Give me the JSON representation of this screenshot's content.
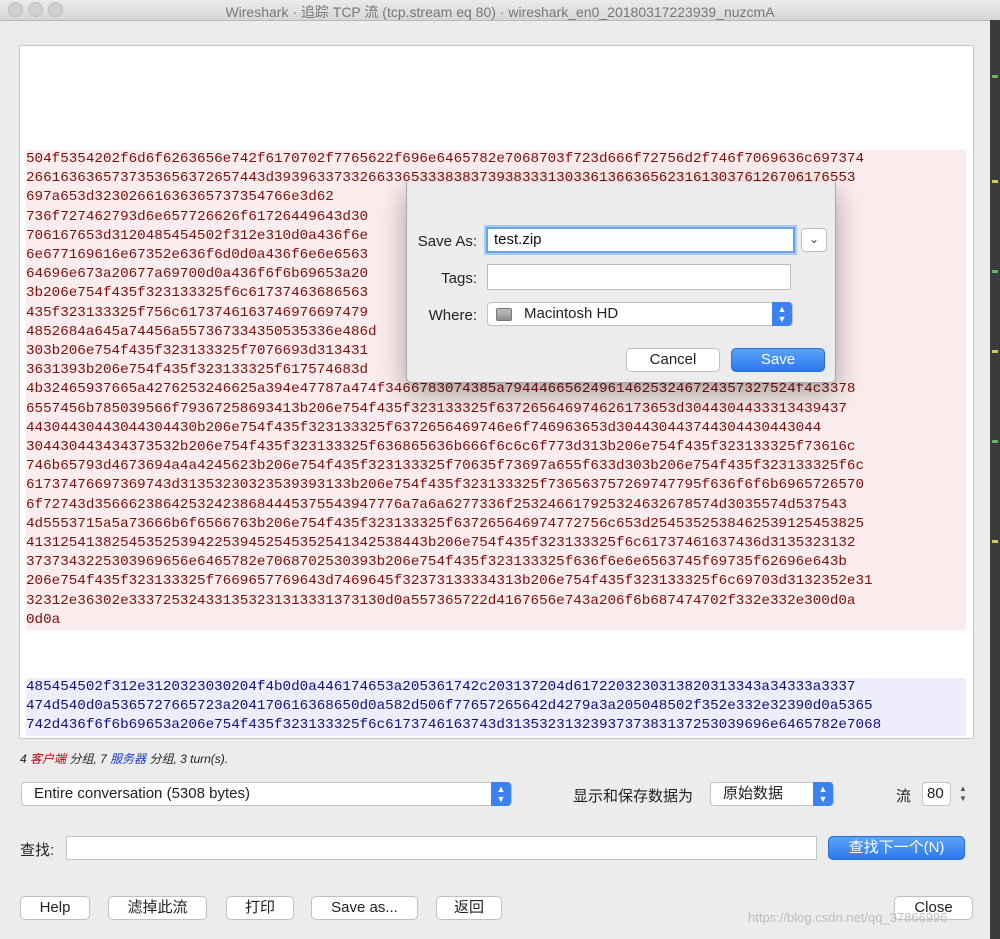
{
  "window": {
    "title": "Wireshark · 追踪 TCP 流 (tcp.stream eq 80) · wireshark_en0_20180317223939_nuzcmA"
  },
  "stream": {
    "client_lines": [
      "504f5354202f6d6f6263656e742f6170702f7765622f696e6465782e7068703f723d666f72756d2f746f7069636c697374",
      "2661636365737353656372657443d39396337332663365333838373938333130336136636562316130376126706176553",
      "697a653d32302661636365737354766e3d62",
      "736f727462793d6e657726626f61726449643d30",
      "706167653d3120485454502f312e310d0a436f6e",
      "6e677169616e67352e636f6d0d0a436f6e6e6563",
      "64696e673a20677a69700d0a436f6f6b69653a20",
      "3b206e754f435f323133325f6c61737463686563",
      "435f323133325f756c6173746163746976697479",
      "4852684a645a74456a557367334350535336e486d",
      "303b206e754f435f323133325f7076693d313431",
      "3631393b206e754f435f323133325f617574683d",
      "4b32465937665a4276253246625a394e47787a474f3466783074385a7944466562496146253246724357327524f4c3378",
      "6557456b785039566f79367258693413b206e754f435f323133325f637265646974626173653d3044304433313439437",
      "44304430443044304430b206e754f435f323133325f6372656469746e6f746963653d304430443744304430443044",
      "304430443434373532b206e754f435f323133325f636865636b666f6c6c6f773d313b206e754f435f323133325f73616c",
      "746b65793d4673694a4a4245623b206e754f435f323133325f70635f73697a655f633d303b206e754f435f323133325f6c",
      "61737476697369743d31353230323539393133b206e754f435f323133325f736563757269747795f636f6f6b6965726570",
      "6f72743d356662386425324238684445375543947776a7a6a6277336f253246617925324632678574d3035574d537543",
      "4d5553715a5a73666b6f6566763b206e754f435f323133325f637265646974772756c653d2545352538462539125453825",
      "41312541382545352539422539452545352541342538443b206e754f435f323133325f6c61737461637436d3135323132",
      "3737343225303969656e6465782e7068702530393b206e754f435f323133325f636f6e6e6563745f69735f62696e643b",
      "206e754f435f323133325f7669657769643d7469645f32373133334313b206e754f435f323133325f6c69703d3132352e31",
      "32312e36302e333725324331353231313331373130d0a557365722d4167656e743a206f6b687474702f332e332e300d0a",
      "0d0a"
    ],
    "server_lines": [
      "485454502f312e3120323030204f4b0d0a446174653a205361742c203137204d6172203230313820313343a34333a3337",
      "474d540d0a5365727665723a204170616368650d0a582d506f77657265642d4279a3a205048502f352e332e32390d0a5365",
      "742d436f6f6b69653a206e754f435f323133325f6c6173746163743d3135323132393737383137253039696e6465782e7068"
    ]
  },
  "save_dialog": {
    "save_as_label": "Save As:",
    "filename": "test.zip",
    "tags_label": "Tags:",
    "tags_value": "",
    "where_label": "Where:",
    "where_value": "Macintosh HD",
    "cancel_label": "Cancel",
    "save_label": "Save"
  },
  "summary": {
    "client_count": "4",
    "client_word": "客户端",
    "part1": " 分组, ",
    "server_count": "7",
    "server_word": "服务器",
    "part2": " 分组, 3 turn(s)."
  },
  "controls": {
    "conversation_select": "Entire conversation (5308 bytes)",
    "show_save_as_label": "显示和保存数据为",
    "format_select": "原始数据",
    "stream_label": "流",
    "stream_number": "80",
    "find_label": "查找:",
    "find_value": "",
    "find_next_button": "查找下一个(N)"
  },
  "buttons": {
    "help": "Help",
    "filter_out": "滤掉此流",
    "print": "打印",
    "save_as": "Save as...",
    "back": "返回",
    "close": "Close"
  },
  "watermark": "https://blog.csdn.net/qq_37866996",
  "colors": {
    "client_text": "#7d0d0d",
    "client_bg": "#fbeded",
    "server_text": "#0f0f7d",
    "server_bg": "#ededfb",
    "accent": "#2c79ee"
  }
}
